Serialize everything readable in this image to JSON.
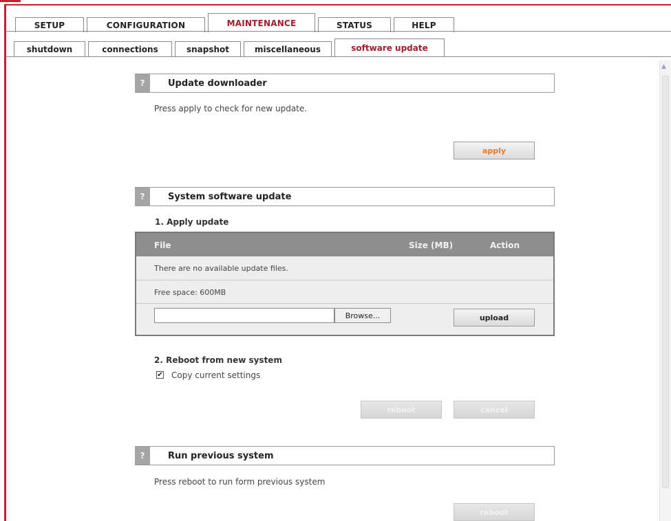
{
  "tabs": {
    "main": [
      "SETUP",
      "CONFIGURATION",
      "MAINTENANCE",
      "STATUS",
      "HELP"
    ],
    "main_active": "MAINTENANCE",
    "sub": [
      "shutdown",
      "connections",
      "snapshot",
      "miscellaneous",
      "software update"
    ],
    "sub_active": "software update"
  },
  "update_downloader": {
    "title": "Update downloader",
    "help_icon": "?",
    "description": "Press apply to check for new update.",
    "apply_label": "apply"
  },
  "system_update": {
    "title": "System software update",
    "help_icon": "?",
    "step1": "1. Apply update",
    "table_headers": {
      "file": "File",
      "size": "Size (MB)",
      "action": "Action"
    },
    "empty_message": "There are no available update files.",
    "free_space": "Free space: 600MB",
    "browse_label": "Browse...",
    "upload_label": "upload",
    "step2": "2. Reboot from new system",
    "copy_settings_label": "Copy current settings",
    "copy_settings_checked": true,
    "reboot_label": "reboot",
    "cancel_label": "cancel"
  },
  "previous_system": {
    "title": "Run previous system",
    "help_icon": "?",
    "description": "Press reboot to run form previous system",
    "reboot_label": "reboot"
  },
  "colors": {
    "accent_red": "#a11d2b",
    "apply_orange": "#e57a2a",
    "header_gray": "#8e8e8e"
  }
}
